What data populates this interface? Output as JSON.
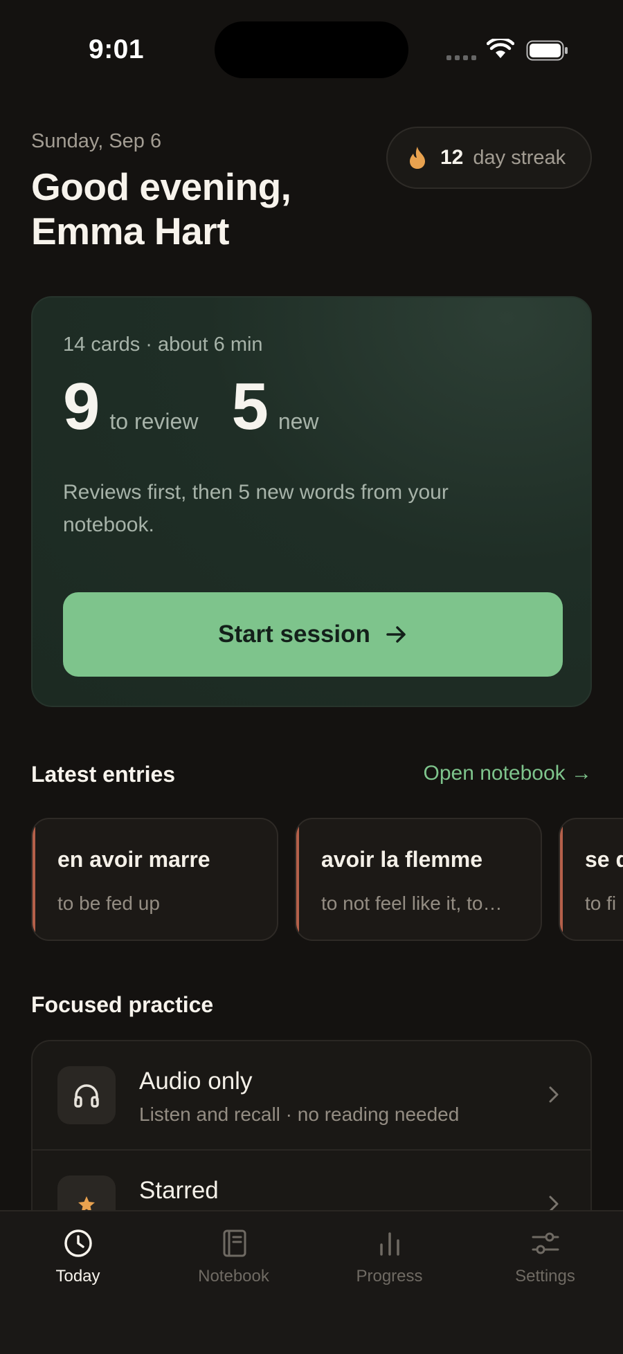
{
  "status_bar": {
    "time": "9:01"
  },
  "header": {
    "date": "Sunday, Sep 6",
    "greeting_line1": "Good evening,",
    "greeting_line2": "Emma Hart",
    "streak_count": "12",
    "streak_label": "day streak"
  },
  "session": {
    "meta": "14 cards · about 6 min",
    "review_count": "9",
    "review_label": "to review",
    "new_count": "5",
    "new_label": "new",
    "description": "Reviews first, then 5 new words from your notebook.",
    "start_label": "Start session"
  },
  "latest_entries": {
    "title": "Latest entries",
    "link": "Open notebook →",
    "items": [
      {
        "term": "en avoir marre",
        "definition": "to be fed up"
      },
      {
        "term": "avoir la flemme",
        "definition": "to not feel like it, to…"
      },
      {
        "term": "se d",
        "definition": "to fi"
      }
    ]
  },
  "focused_practice": {
    "title": "Focused practice",
    "items": [
      {
        "title": "Audio only",
        "subtitle": "Listen and recall · no reading needed",
        "icon": "headphones-icon"
      },
      {
        "title": "Starred",
        "subtitle": "",
        "icon": "star-icon"
      }
    ]
  },
  "tab_bar": {
    "items": [
      {
        "label": "Today",
        "icon": "clock-icon",
        "active": true
      },
      {
        "label": "Notebook",
        "icon": "notebook-icon",
        "active": false
      },
      {
        "label": "Progress",
        "icon": "bar-chart-icon",
        "active": false
      },
      {
        "label": "Settings",
        "icon": "sliders-icon",
        "active": false
      }
    ]
  },
  "colors": {
    "background": "#141210",
    "accent": "#7ec48c",
    "streak_flame": "#e9a24f",
    "entry_stripe": "#b5604a"
  }
}
